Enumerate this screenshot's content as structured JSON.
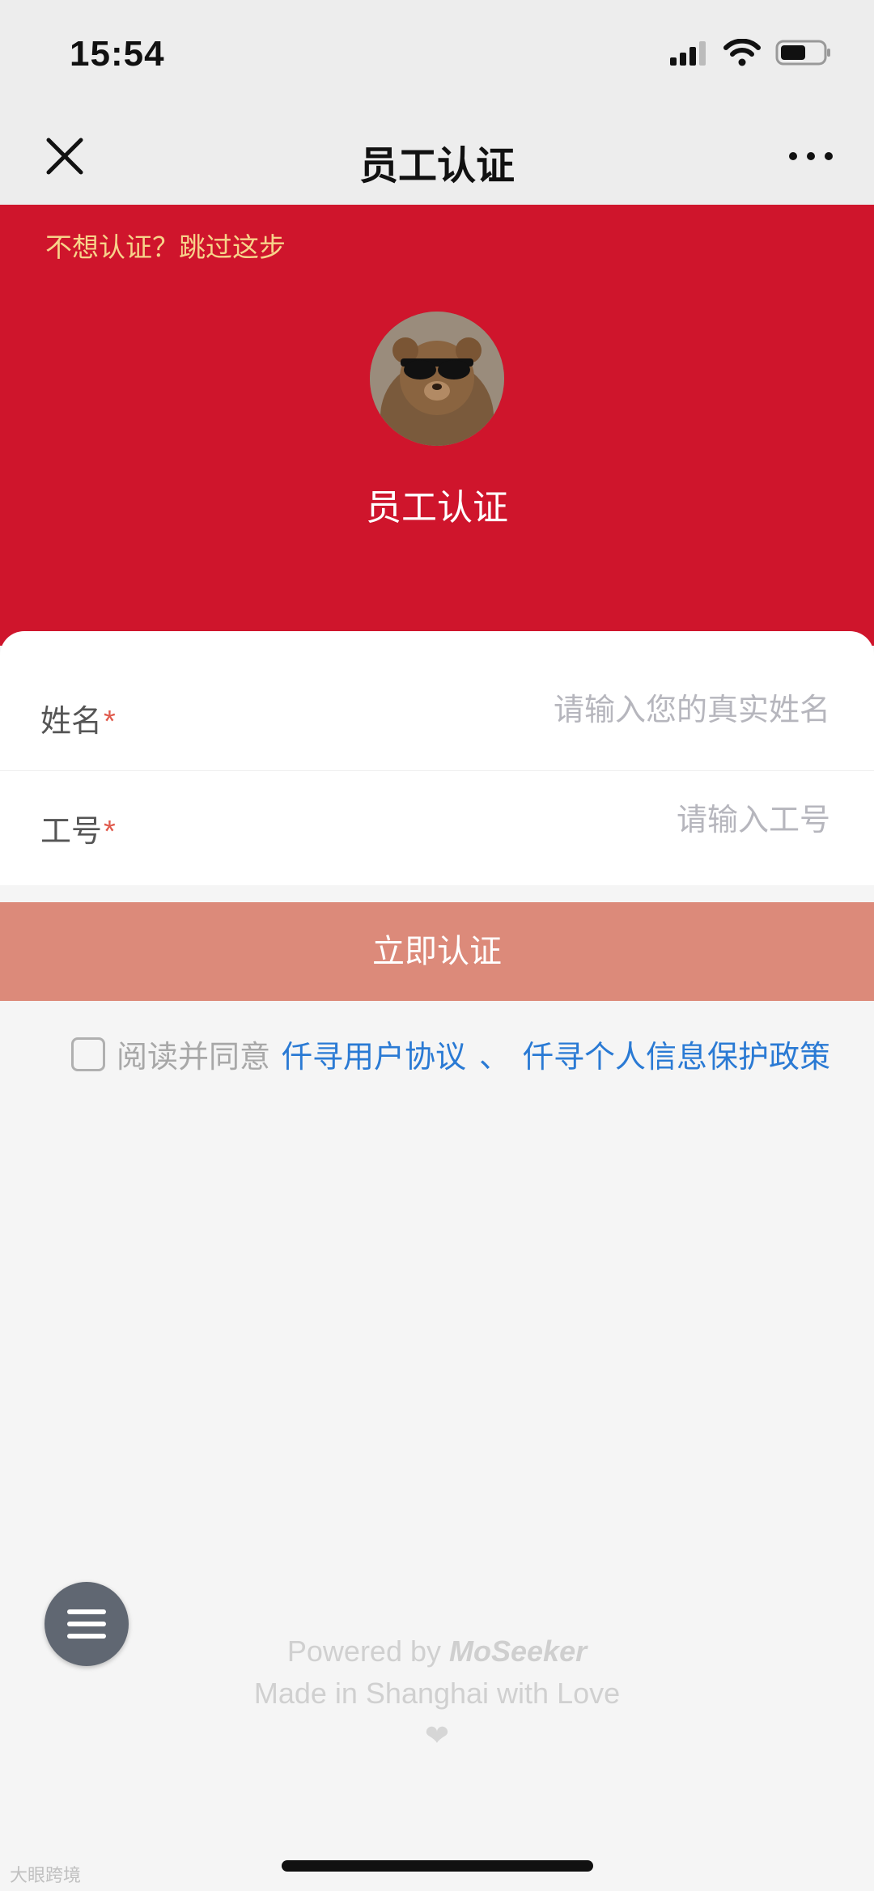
{
  "status_bar": {
    "time": "15:54"
  },
  "nav": {
    "title": "员工认证"
  },
  "hero": {
    "skip_text": "不想认证？跳过这步",
    "title": "员工认证",
    "bg_color": "#cf152c"
  },
  "form": {
    "name_label": "姓名",
    "name_required_mark": "*",
    "name_placeholder": "请输入您的真实姓名",
    "id_label": "工号",
    "id_required_mark": "*",
    "id_placeholder": "请输入工号"
  },
  "submit": {
    "label": "立即认证",
    "color": "#dc8a7a"
  },
  "agreement": {
    "prefix": "阅读并同意",
    "link1": "仟寻用户协议",
    "separator": "、",
    "link2": "仟寻个人信息保护政策"
  },
  "footer": {
    "powered_prefix": "Powered by",
    "brand": "MoSeeker",
    "made_in": "Made in Shanghai with Love"
  },
  "watermark": {
    "text": "大眼跨境"
  },
  "icons": {
    "close": "close-icon",
    "more": "more-icon",
    "menu": "menu-icon"
  }
}
